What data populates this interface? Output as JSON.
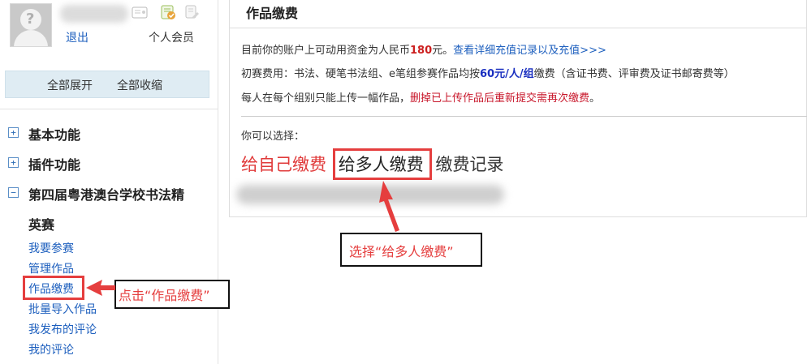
{
  "sidebar": {
    "logout": "退出",
    "member": "个人会员",
    "expand_all": "全部展开",
    "collapse_all": "全部收缩",
    "groups": [
      {
        "label": "基本功能",
        "toggle": "+"
      },
      {
        "label": "插件功能",
        "toggle": "+"
      },
      {
        "label": "第四届粤港澳台学校书法精",
        "label2": "英赛",
        "toggle": "−"
      }
    ],
    "sub_items": [
      "我要参赛",
      "管理作品",
      "作品缴费",
      "批量导入作品",
      "我发布的评论",
      "我的评论"
    ]
  },
  "main": {
    "title": "作品缴费",
    "balance_prefix": "目前你的账户上可动用资金为人民币",
    "balance_amount": "180",
    "balance_suffix": "元。",
    "recharge_link": "查看详细充值记录以及充值>>>",
    "fee_prefix": "初赛费用：书法、硬笔书法组、e笔组参赛作品均按",
    "fee_amount": "60元/人/组",
    "fee_suffix": "缴费（含证书费、评审费及证书邮寄费等）",
    "rule_prefix": "每人在每个组别只能上传一幅作品，",
    "rule_warning": "删掉已上传作品后重新提交需再次缴费",
    "rule_suffix": "。",
    "choose_label": "你可以选择：",
    "options": [
      "给自己缴费",
      "给多人缴费",
      "缴费记录"
    ]
  },
  "annotations": {
    "click_note": "点击“作品缴费”",
    "select_note": "选择“给多人缴费”"
  },
  "colors": {
    "accent_red": "#e53e3e",
    "link_blue": "#1d5fbe",
    "toggle_bar": "#dfecf3"
  }
}
